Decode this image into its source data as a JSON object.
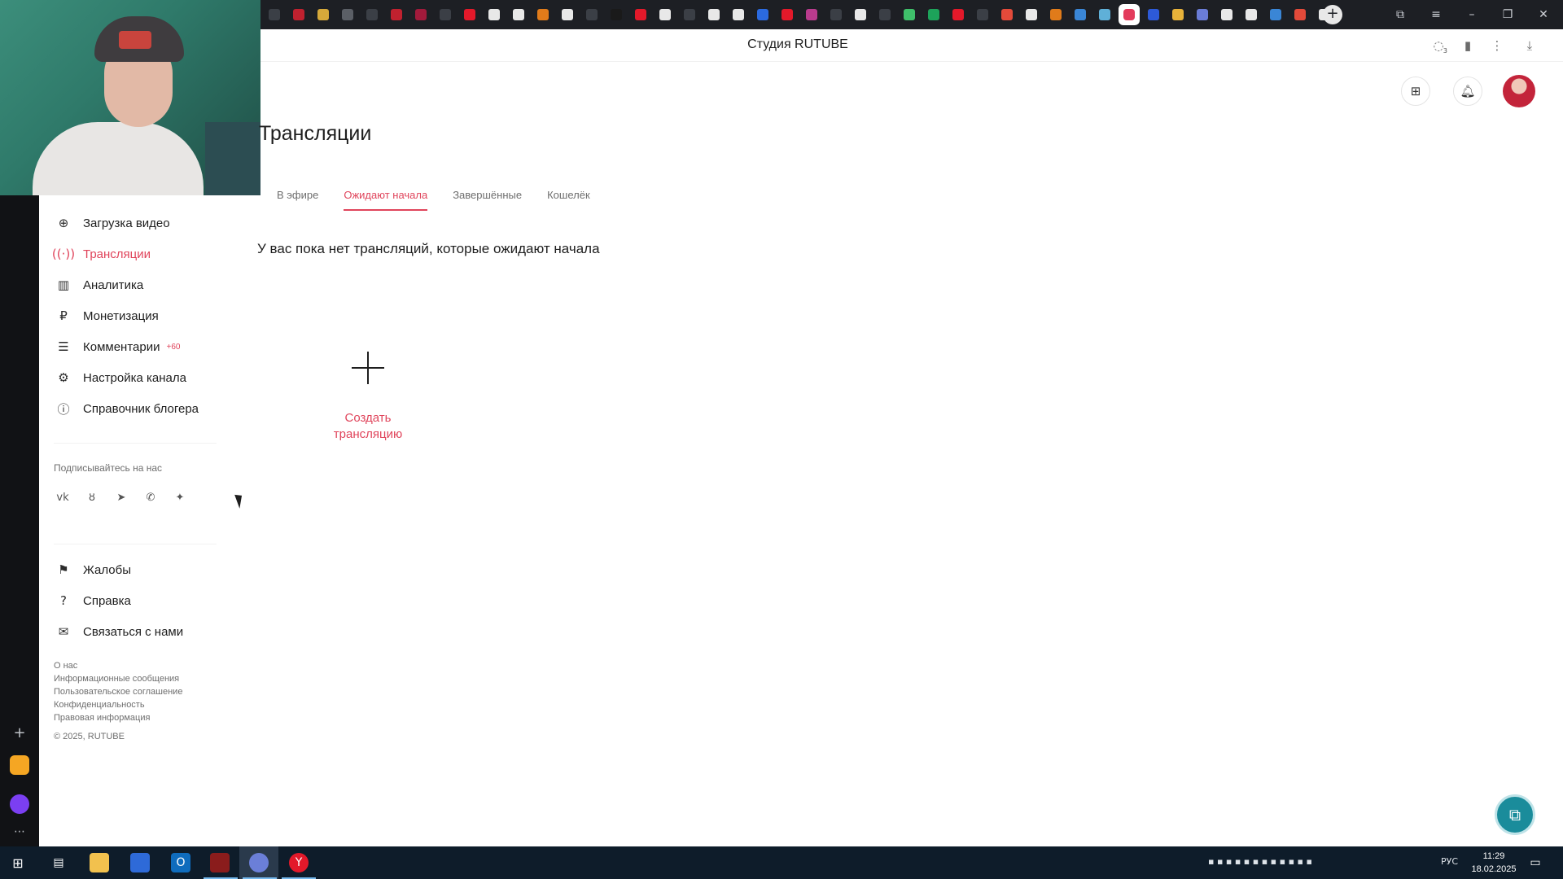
{
  "browser": {
    "page_title": "Студия RUTUBE",
    "notifications_count": "3",
    "tab_colors": [
      "#3b3f46",
      "#c0212f",
      "#d6a93a",
      "#5b5f66",
      "#3b3f46",
      "#c0212f",
      "#a11a3b",
      "#3b3f46",
      "#e3192a",
      "#e8e8e8",
      "#e8e8e8",
      "#e07b1a",
      "#e8e8e8",
      "#3b3f46",
      "#1a1a1a",
      "#e3192a",
      "#e8e8e8",
      "#3b3f46",
      "#e8e8e8",
      "#e8e8e8",
      "#2b6ae0",
      "#e3192a",
      "#b93b8d",
      "#3b3f46",
      "#e8e8e8",
      "#3b3f46",
      "#3fbf6a",
      "#1da35a",
      "#e3192a",
      "#3b3f46",
      "#e34a3a",
      "#e8e8e8",
      "#e07b1a",
      "#3a86d6",
      "#5fb0d8",
      "#e33b5c",
      "#2d5ad8",
      "#e8b23a",
      "#6a7cd6",
      "#e8e8e8",
      "#e8e8e8",
      "#3a86d6",
      "#e34a3a",
      "#e8e8e8"
    ],
    "active_tab_index": 35
  },
  "sidebar": {
    "items": [
      {
        "label": "Загрузка видео",
        "icon": "upload-icon",
        "active": false
      },
      {
        "label": "Трансляции",
        "icon": "broadcast-icon",
        "active": true
      },
      {
        "label": "Аналитика",
        "icon": "analytics-icon",
        "active": false
      },
      {
        "label": "Монетизация",
        "icon": "ruble-icon",
        "active": false
      },
      {
        "label": "Комментарии",
        "icon": "comment-icon",
        "active": false,
        "badge": "+60"
      },
      {
        "label": "Настройка канала",
        "icon": "gear-icon",
        "active": false
      },
      {
        "label": "Справочник блогера",
        "icon": "guide-icon",
        "active": false
      }
    ],
    "subscribe_caption": "Подписывайтесь на нас",
    "social": [
      "vk-icon",
      "ok-icon",
      "telegram-icon",
      "viber-icon",
      "more-icon"
    ],
    "bottom_items": [
      {
        "label": "Жалобы",
        "icon": "flag-icon"
      },
      {
        "label": "Справка",
        "icon": "help-icon"
      },
      {
        "label": "Связаться с нами",
        "icon": "mail-icon"
      }
    ],
    "footer_links": [
      "О нас",
      "Информационные сообщения",
      "Пользовательское соглашение",
      "Конфиденциальность",
      "Правовая информация"
    ],
    "copyright": "© 2025, RUTUBE"
  },
  "main": {
    "title": "Трансляции",
    "tabs": [
      {
        "label": "В эфире",
        "active": false
      },
      {
        "label": "Ожидают начала",
        "active": true
      },
      {
        "label": "Завершённые",
        "active": false
      },
      {
        "label": "Кошелёк",
        "active": false
      }
    ],
    "empty_message": "У вас пока нет трансляций, которые ожидают начала",
    "create_label": "Создать трансляцию"
  },
  "colors": {
    "accent": "#e0445b",
    "text": "#1e1e1e",
    "muted": "#6e6e6e"
  },
  "taskbar": {
    "language": "РУС",
    "time": "11:29",
    "date": "18.02.2025"
  }
}
